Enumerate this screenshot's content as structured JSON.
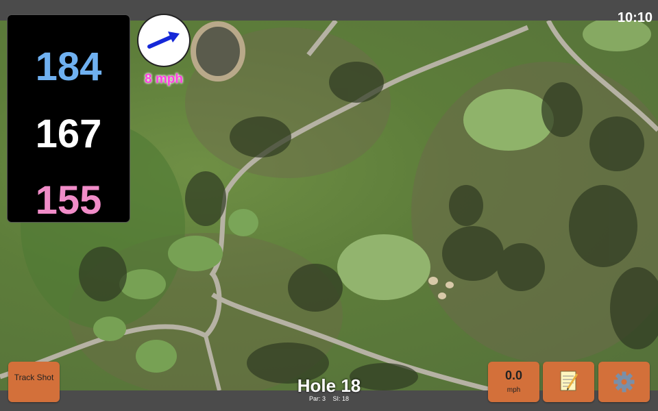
{
  "status": {
    "time": "10:10"
  },
  "distances": {
    "back": "184",
    "middle": "167",
    "front": "155"
  },
  "wind": {
    "speed": "8 mph",
    "icon": "wind-arrow-icon"
  },
  "buttons": {
    "track_shot": "Track Shot",
    "speed_value": "0.0",
    "speed_unit": "mph",
    "notes_icon": "notepad-icon",
    "settings_icon": "gear-icon"
  },
  "hole": {
    "title": "Hole 18",
    "par": "Par: 3",
    "si": "SI: 18"
  },
  "colors": {
    "back": "#6fb0f0",
    "middle": "#ffffff",
    "front": "#f08cc8",
    "wind_text": "#ff40e0",
    "button": "#d3703a"
  }
}
